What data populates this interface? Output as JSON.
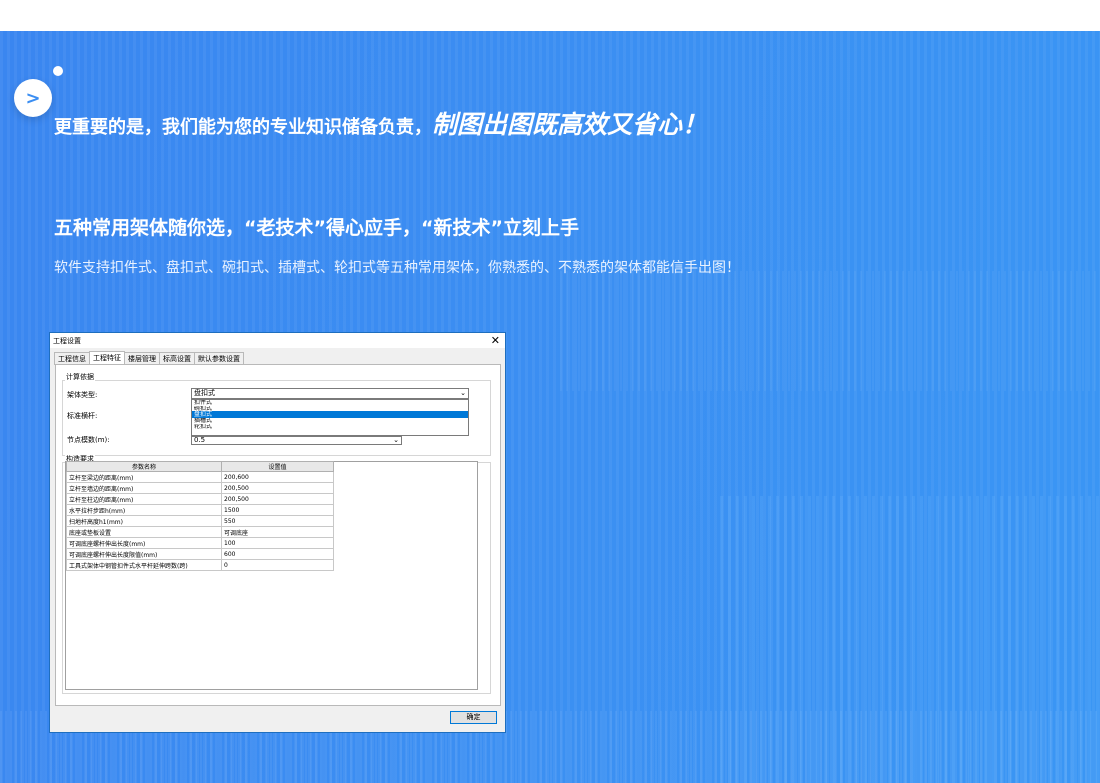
{
  "headline": {
    "normal": "更重要的是，我们能为您的专业知识储备负责，",
    "emphasis": "制图出图既高效又省心！"
  },
  "nav": {
    "icon": "chevron-right-icon",
    "glyph": ">"
  },
  "subheading": "五种常用架体随你选，“老技术”得心应手，“新技术”立刻上手",
  "description": "软件支持扣件式、盘扣式、碗扣式、插槽式、轮扣式等五种常用架体，你熟悉的、不熟悉的架体都能信手出图！",
  "dialog": {
    "title": "工程设置",
    "close_glyph": "✕",
    "tabs": [
      "工程信息",
      "工程特征",
      "楼层管理",
      "标高设置",
      "默认参数设置"
    ],
    "active_tab": "工程特征",
    "calc_basis_group": "计算依据",
    "frame_type_label": "架体类型:",
    "frame_type_value": "盘扣式",
    "frame_type_options": [
      "扣件式",
      "碗扣式",
      "盘扣式",
      "插槽式",
      "轮扣式"
    ],
    "standard_pole_label": "标准横杆:",
    "node_modulus_label": "节点模数(m):",
    "node_modulus_value": "0.5",
    "construction_group": "构造要求",
    "table": {
      "headers": [
        "参数名称",
        "设置值"
      ],
      "rows": [
        [
          "立杆至梁边的距离(mm)",
          "200,600"
        ],
        [
          "立杆至墙边的距离(mm)",
          "200,500"
        ],
        [
          "立杆至柱边的距离(mm)",
          "200,500"
        ],
        [
          "水平拉杆步距h(mm)",
          "1500"
        ],
        [
          "扫地杆高度h1(mm)",
          "550"
        ],
        [
          "底座或垫板设置",
          "可调底座"
        ],
        [
          "可调底座螺杆伸出长度(mm)",
          "100"
        ],
        [
          "可调底座螺杆伸出长度限值(mm)",
          "600"
        ],
        [
          "工具式架体中钢管扣件式水平杆延伸跨数(跨)",
          "0"
        ]
      ]
    },
    "ok_label": "确定"
  },
  "colors": {
    "banner": "#3b8ef2",
    "selection": "#0078d7"
  }
}
